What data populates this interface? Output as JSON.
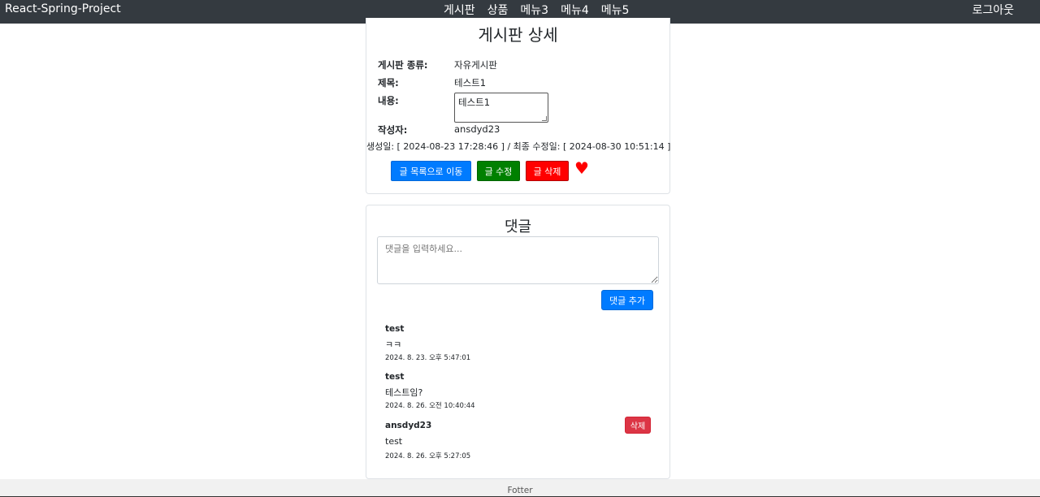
{
  "navbar": {
    "brand": "React-Spring-Project",
    "menu": [
      "게시판",
      "상품",
      "메뉴3",
      "메뉴4",
      "메뉴5"
    ],
    "logout": "로그아웃"
  },
  "detail": {
    "title": "게시판 상세",
    "fields": {
      "type_label": "게시판 종류:",
      "type_value": "자유게시판",
      "subject_label": "제목:",
      "subject_value": "테스트1",
      "content_label": "내용:",
      "content_value": "테스트1",
      "author_label": "작성자:",
      "author_value": "ansdyd23"
    },
    "dates": "생성일: [ 2024-08-23 17:28:46 ] / 최종 수정일: [ 2024-08-30 10:51:14 ]",
    "buttons": {
      "list": "글 목록으로 이동",
      "edit": "글 수정",
      "delete": "글 삭제"
    },
    "heart_icon": "♥"
  },
  "comments": {
    "title": "댓글",
    "placeholder": "댓글을 입력하세요...",
    "add_label": "댓글 추가",
    "items": [
      {
        "author": "test",
        "text": "ㅋㅋ",
        "date": "2024. 8. 23. 오후 5:47:01"
      },
      {
        "author": "test",
        "text": "테스트임?",
        "date": "2024. 8. 26. 오전 10:40:44"
      },
      {
        "author": "ansdyd23",
        "text": "test",
        "date": "2024. 8. 26. 오후 5:27:05",
        "delete_label": "삭제"
      }
    ]
  },
  "footer": {
    "text": "Fotter"
  },
  "colors": {
    "navbar": "#343a40",
    "primary": "#007bff",
    "edit": "#008000",
    "delete": "#ff0000",
    "danger": "#dc3545"
  }
}
